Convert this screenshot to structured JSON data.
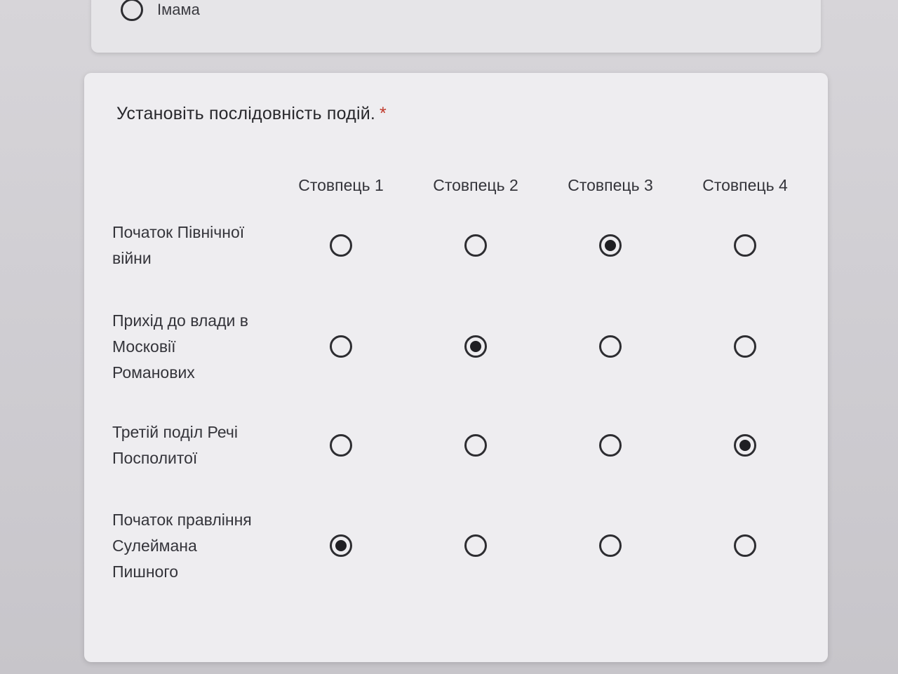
{
  "previous_question": {
    "option_label": "Імама",
    "option_checked": false
  },
  "question": {
    "title": "Установіть послідовність подій.",
    "required_marker": "*"
  },
  "grid": {
    "columns": [
      "Стовпець 1",
      "Стовпець 2",
      "Стовпець 3",
      "Стовпець 4"
    ],
    "rows": [
      {
        "label": "Початок Північної війни",
        "selected_column": 3
      },
      {
        "label": "Прихід до влади в Московії Романових",
        "selected_column": 2
      },
      {
        "label": "Третій поділ Речі Посполитої",
        "selected_column": 4
      },
      {
        "label": "Початок правління Сулеймана Пишного",
        "selected_column": 1
      }
    ]
  }
}
